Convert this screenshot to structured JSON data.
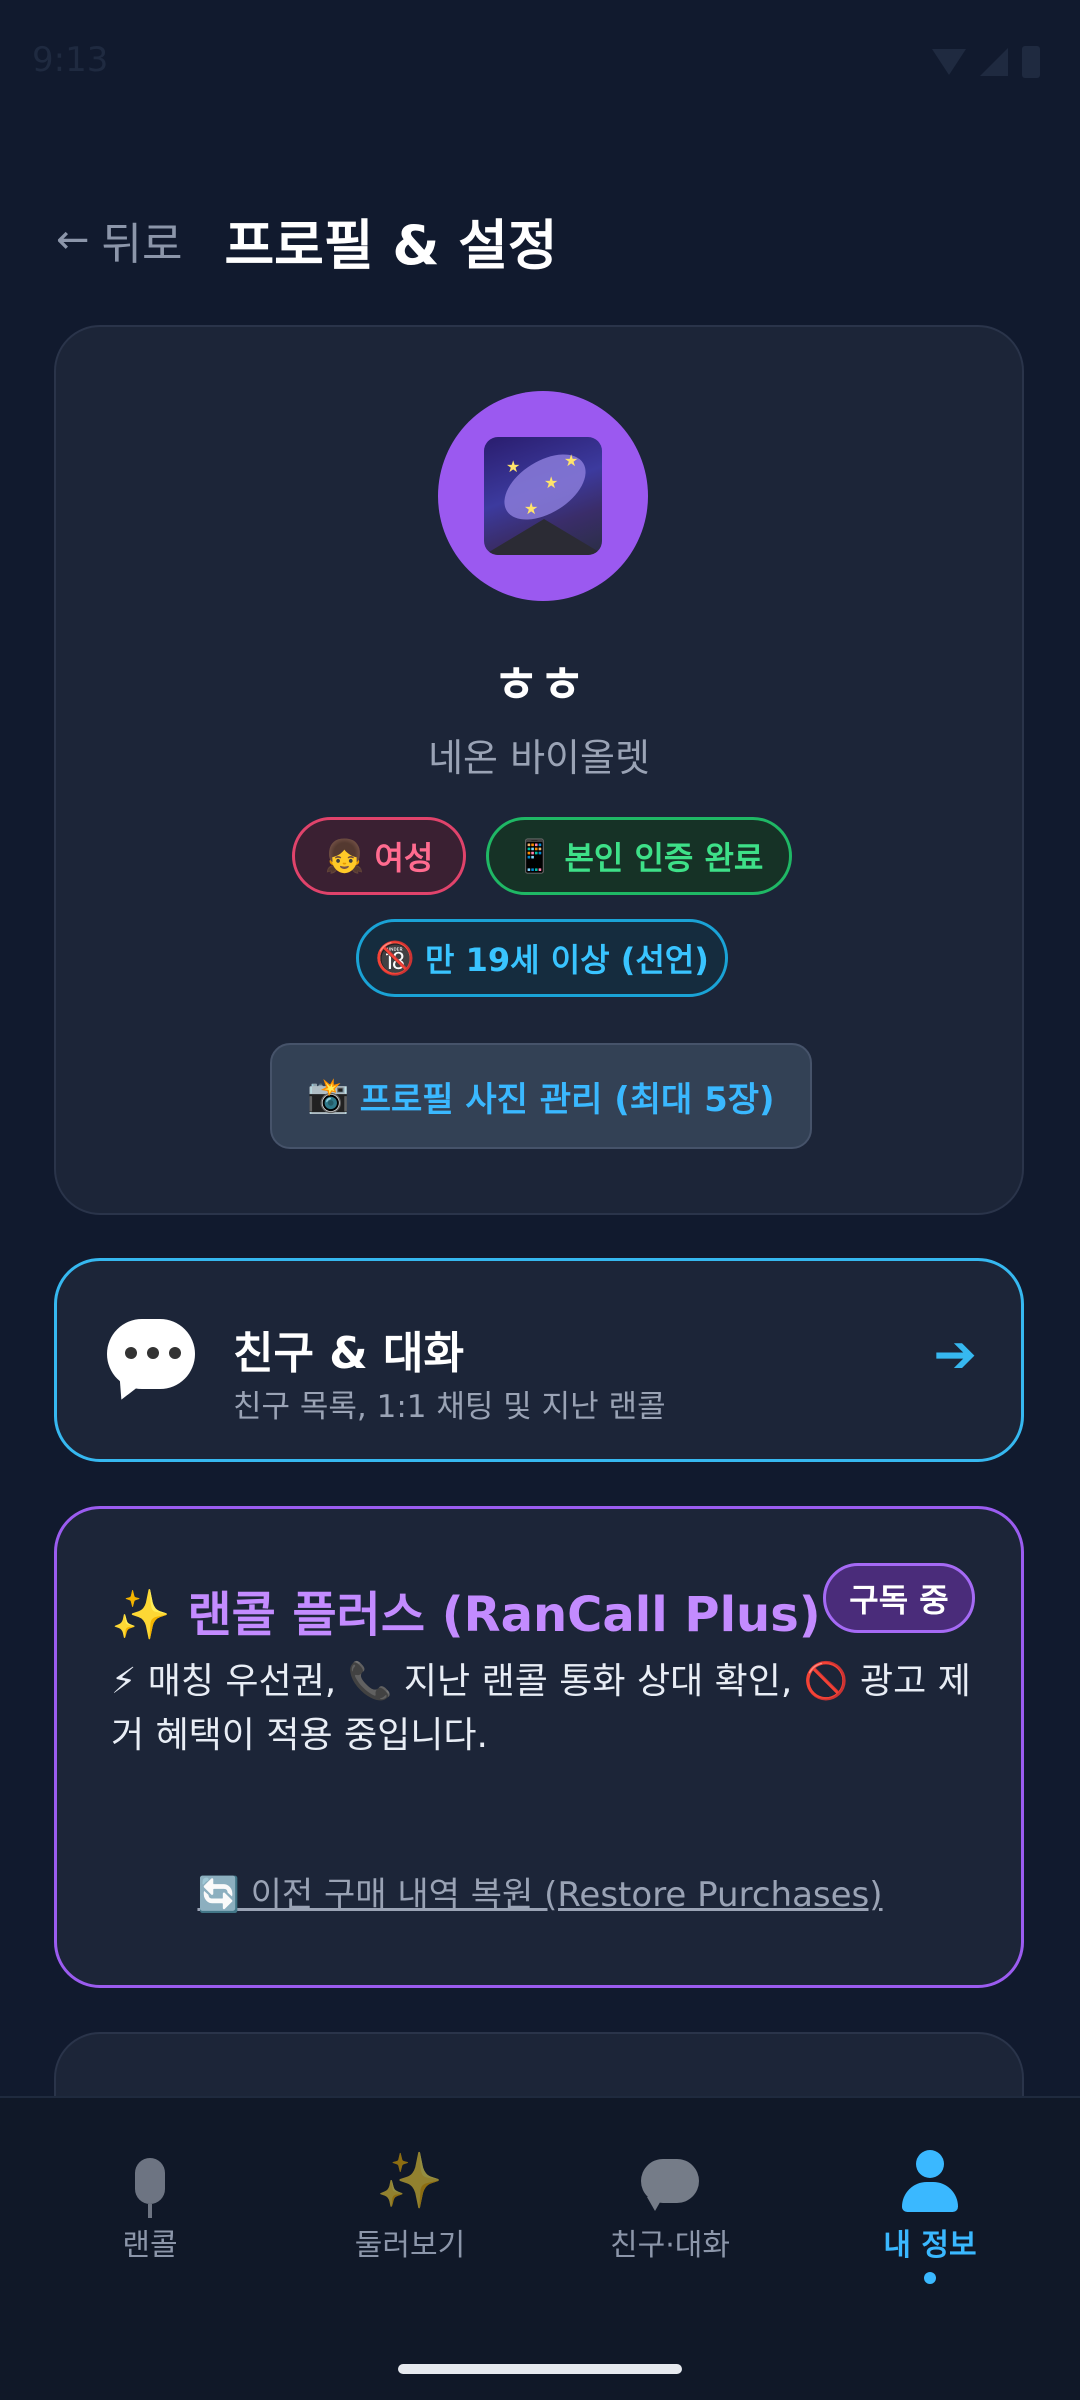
{
  "status_bar": {
    "time": "9:13"
  },
  "header": {
    "back_arrow": "←",
    "back_label": "뒤로",
    "title": "프로필 & 설정"
  },
  "profile": {
    "avatar_icon": "milky-way-emoji",
    "name": "ㅎㅎ",
    "subtitle": "네온 바이올렛",
    "badges": {
      "gender": {
        "emoji": "👧",
        "label": "여성"
      },
      "verified": {
        "emoji": "📱",
        "label": "본인 인증 완료"
      },
      "adult": {
        "emoji": "🔞",
        "label": "만 19세 이상 (선언)"
      }
    },
    "photo_button": {
      "emoji": "📸",
      "label": "프로필 사진 관리 (최대 5장)"
    }
  },
  "friends_card": {
    "icon": "speech-bubble-icon",
    "title": "친구 & 대화",
    "subtitle": "친구 목록, 1:1 채팅 및 지난 랜콜",
    "arrow": "➔"
  },
  "plus_card": {
    "title": "✨ 랜콜 플러스 (RanCall Plus)",
    "badge": "구독 중",
    "description": "⚡ 매칭 우선권, 📞 지난 랜콜 통화 상대 확인, 🚫 광고 제거 혜택이 적용 중입니다.",
    "restore_link": "🔄 이전 구매 내역 복원 (Restore Purchases)"
  },
  "bottom_nav": {
    "items": [
      {
        "label": "랜콜",
        "icon": "microphone-icon"
      },
      {
        "label": "둘러보기",
        "icon": "sparkles-icon"
      },
      {
        "label": "친구·대화",
        "icon": "speech-bubble-icon"
      },
      {
        "label": "내 정보",
        "icon": "person-icon",
        "active": true
      }
    ]
  },
  "colors": {
    "background": "#111a2e",
    "card": "#1c2538",
    "accent_blue": "#3ab8ff",
    "accent_purple": "#9b5cf0",
    "female_pink": "#e0436b",
    "verified_green": "#1fb865"
  }
}
